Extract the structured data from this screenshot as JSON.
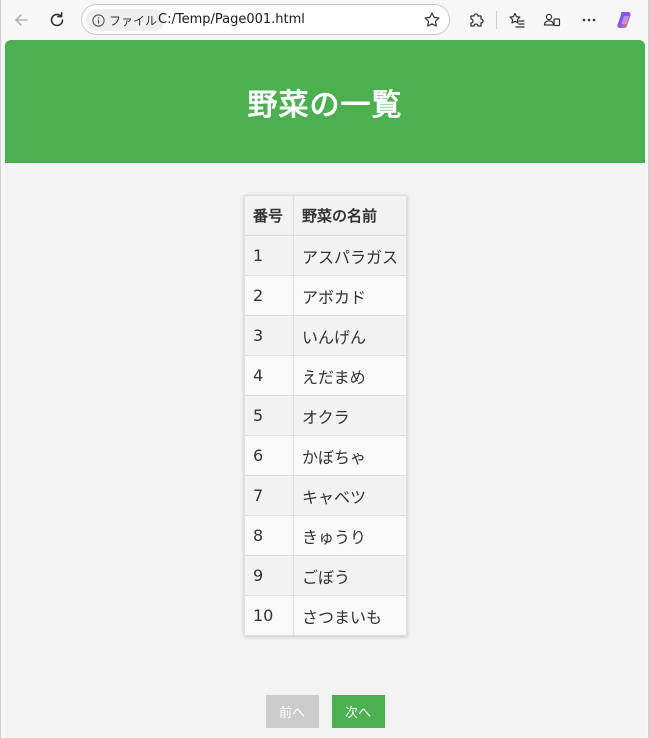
{
  "browser": {
    "info_label": "ファイル",
    "url": "C:/Temp/Page001.html"
  },
  "page": {
    "title": "野菜の一覧",
    "table": {
      "headers": [
        "番号",
        "野菜の名前"
      ],
      "rows": [
        [
          "1",
          "アスパラガス"
        ],
        [
          "2",
          "アボカド"
        ],
        [
          "3",
          "いんげん"
        ],
        [
          "4",
          "えだまめ"
        ],
        [
          "5",
          "オクラ"
        ],
        [
          "6",
          "かぼちゃ"
        ],
        [
          "7",
          "キャベツ"
        ],
        [
          "8",
          "きゅうり"
        ],
        [
          "9",
          "ごぼう"
        ],
        [
          "10",
          "さつまいも"
        ]
      ]
    },
    "pager": {
      "prev_label": "前へ",
      "next_label": "次へ"
    }
  },
  "colors": {
    "header_bg": "#4caf50",
    "prev_button_bg": "#cccccc",
    "next_button_bg": "#4caf50"
  }
}
